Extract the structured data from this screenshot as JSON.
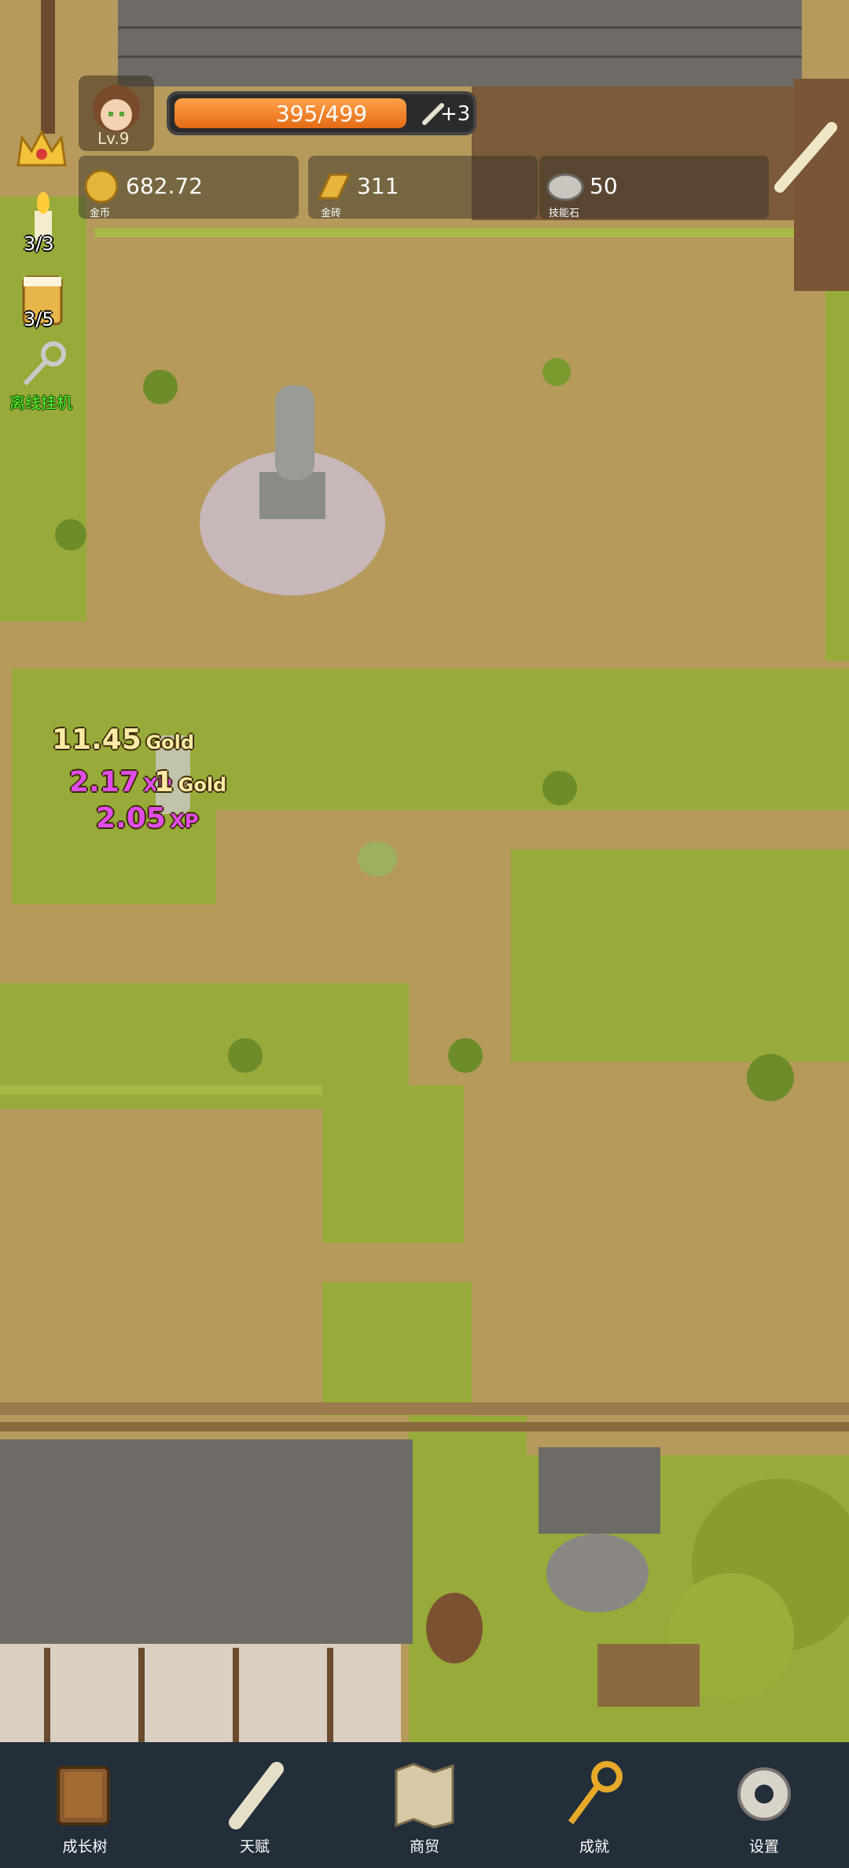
{
  "hud": {
    "level": "Lv.9",
    "xp_text": "395/499",
    "xp_fraction": 0.79,
    "xp_bonus": "+3",
    "resources": [
      {
        "name": "coin-icon",
        "value": "682.72",
        "caption": "金币"
      },
      {
        "name": "gold-bar-icon",
        "value": "311",
        "caption": "金砖"
      },
      {
        "name": "skill-stone-icon",
        "value": "50",
        "caption": "技能石"
      }
    ],
    "candle_count": "3/3",
    "beer_count": "3/5",
    "idle_label": "离线挂机"
  },
  "floating_texts": [
    {
      "value": "11.45",
      "unit": "Gold",
      "color": "#fbe9a6"
    },
    {
      "value": "2.17",
      "unit": "XP",
      "color": "#e04ce8"
    },
    {
      "value": "1",
      "unit": "Gold",
      "color": "#fbe9a6"
    },
    {
      "value": "2.05",
      "unit": "XP",
      "color": "#e04ce8"
    }
  ],
  "nav": [
    {
      "label": "成长树",
      "icon": "book-icon"
    },
    {
      "label": "天赋",
      "icon": "scroll-icon"
    },
    {
      "label": "商贸",
      "icon": "map-icon"
    },
    {
      "label": "成就",
      "icon": "key-icon"
    },
    {
      "label": "设置",
      "icon": "gear-icon"
    }
  ],
  "colors": {
    "nav_bg": "#222e3a",
    "xp_orange": "#f07d22",
    "grass": "#96a93a",
    "dirt": "#b59a5c"
  }
}
